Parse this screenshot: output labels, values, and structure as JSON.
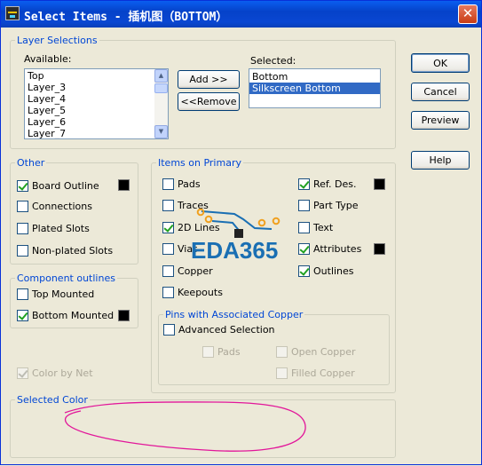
{
  "window": {
    "title": "Select Items - 插机图（BOTTOM）",
    "close_glyph": "✕"
  },
  "layer_selections": {
    "legend": "Layer Selections",
    "available_label": "Available:",
    "available_items": [
      "Top",
      "Layer_3",
      "Layer_4",
      "Layer_5",
      "Layer_6",
      "Layer_7"
    ],
    "add_button": "Add >>",
    "remove_button": "<<Remove",
    "selected_label": "Selected:",
    "selected_items": [
      "Bottom",
      "Silkscreen Bottom"
    ],
    "selected_highlighted": "Silkscreen Bottom"
  },
  "dialog_buttons": {
    "ok": "OK",
    "cancel": "Cancel",
    "preview": "Preview",
    "help": "Help"
  },
  "other": {
    "legend": "Other",
    "board_outline": {
      "label": "Board Outline",
      "checked": true
    },
    "connections": {
      "label": "Connections",
      "checked": false
    },
    "plated_slots": {
      "label": "Plated Slots",
      "checked": false
    },
    "non_plated_slots": {
      "label": "Non-plated Slots",
      "checked": false
    }
  },
  "component_outlines": {
    "legend": "Component outlines",
    "top_mounted": {
      "label": "Top Mounted",
      "checked": false
    },
    "bottom_mounted": {
      "label": "Bottom Mounted",
      "checked": true
    }
  },
  "color_by_net": {
    "label": "Color by Net",
    "checked": true,
    "enabled": false
  },
  "items_on_primary": {
    "legend": "Items on Primary",
    "pads": {
      "label": "Pads",
      "checked": false
    },
    "traces": {
      "label": "Traces",
      "checked": false
    },
    "lines_2d": {
      "label": "2D Lines",
      "checked": true
    },
    "vias": {
      "label": "Vias",
      "checked": false
    },
    "copper": {
      "label": "Copper",
      "checked": false
    },
    "keepouts": {
      "label": "Keepouts",
      "checked": false
    },
    "ref_des": {
      "label": "Ref. Des.",
      "checked": true
    },
    "part_type": {
      "label": "Part Type",
      "checked": false
    },
    "text": {
      "label": "Text",
      "checked": false
    },
    "attributes": {
      "label": "Attributes",
      "checked": true
    },
    "outlines": {
      "label": "Outlines",
      "checked": true
    }
  },
  "pins_with_copper": {
    "legend": "Pins with Associated Copper",
    "advanced_selection": {
      "label": "Advanced Selection",
      "checked": false
    },
    "pads": {
      "label": "Pads",
      "checked": false,
      "enabled": false
    },
    "open_copper": {
      "label": "Open Copper",
      "checked": false,
      "enabled": false
    },
    "filled_copper": {
      "label": "Filled Copper",
      "checked": false,
      "enabled": false
    }
  },
  "selected_color": {
    "legend": "Selected Color"
  },
  "watermark": {
    "text": "EDA365",
    "color": "#1a6fb3",
    "trace_color": "#f0a01e"
  },
  "annotation": {
    "stroke_color": "#e2169a"
  },
  "colors": {
    "swatch": "#000000",
    "group_label": "#0046d5",
    "title_bar": "#0a5ef0"
  }
}
